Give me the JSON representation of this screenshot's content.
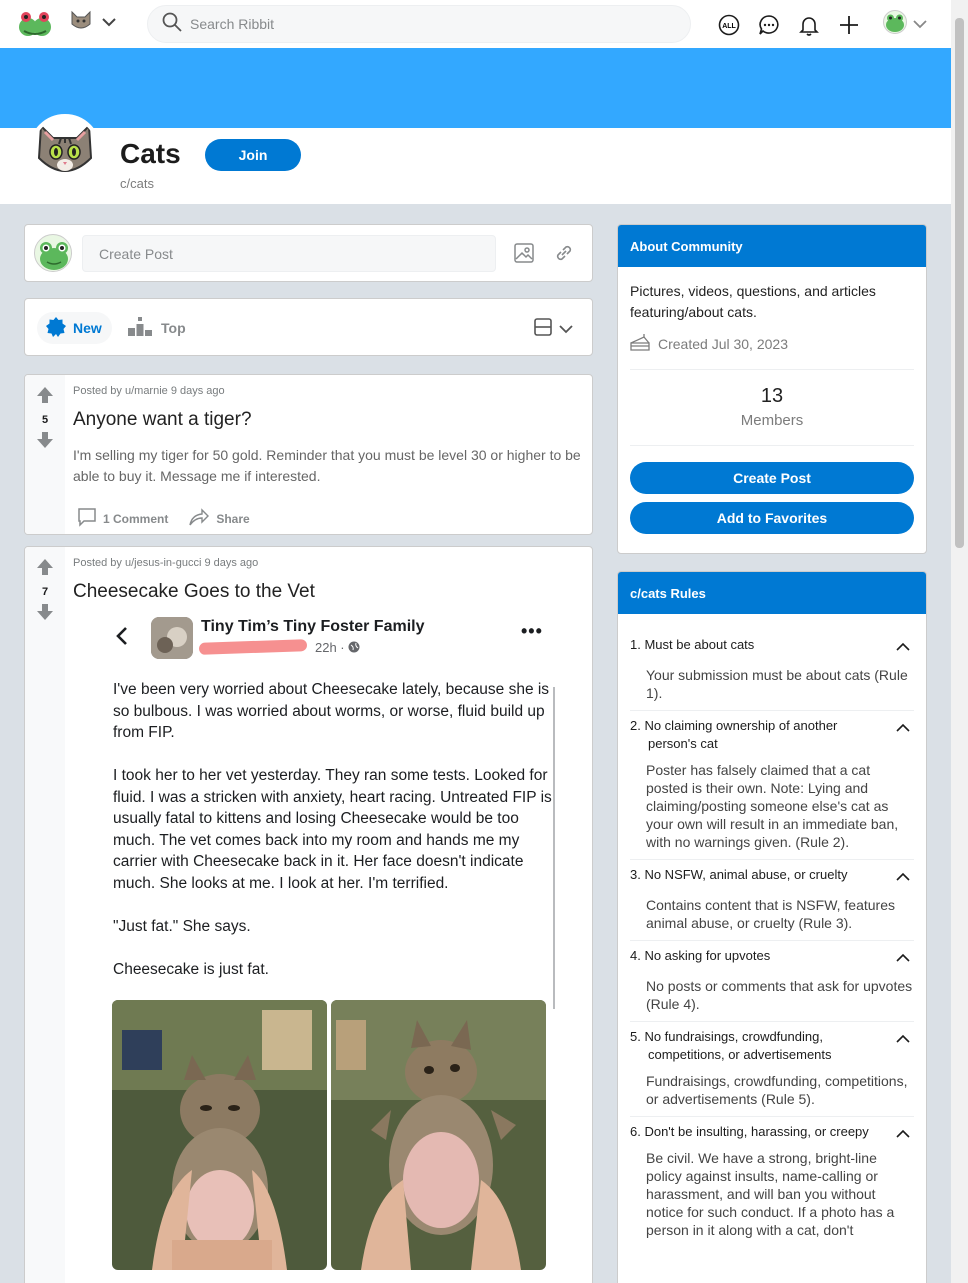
{
  "nav": {
    "search_placeholder": "Search Ribbit",
    "icons": [
      "ribbit-logo-icon",
      "community-cat-icon",
      "chevron-down-icon",
      "all-icon",
      "chat-icon",
      "bell-icon",
      "plus-icon",
      "avatar-frog",
      "chevron-down-icon"
    ],
    "all_label": "ALL"
  },
  "community": {
    "name": "Cats",
    "slug": "c/cats",
    "join_label": "Join",
    "banner_color": "#33a8ff",
    "accent_color": "#0079d3"
  },
  "create_post": {
    "placeholder": "Create Post"
  },
  "sort": {
    "new_label": "New",
    "top_label": "Top"
  },
  "posts": [
    {
      "meta": "Posted by u/marnie 9 days ago",
      "votes": "5",
      "title": "Anyone want a tiger?",
      "body": "I'm selling my tiger for 50 gold. Reminder that you must be level 30 or higher to be able to buy it. Message me if interested.",
      "comments_label": "1 Comment",
      "share_label": "Share"
    },
    {
      "meta": "Posted by u/jesus-in-gucci 9 days ago",
      "votes": "7",
      "title": "Cheesecake Goes to the Vet",
      "embed": {
        "name": "Tiny Tim’s Tiny Foster Family",
        "time": "22h ·",
        "paragraphs": [
          "I've been very worried about Cheesecake lately, because she is so bulbous. I was worried about worms, or worse, fluid build up from FIP.",
          "I took her to her vet yesterday. They ran some tests. Looked for fluid. I was a stricken with anxiety, heart racing. Untreated FIP is usually fatal to kittens and losing Cheesecake would be too much. The vet comes back into my room and hands me my carrier with Cheesecake back in it. Her face doesn't indicate much. She looks at me. I look at her. I'm terrified.",
          "\"Just fat.\" She says.",
          "Cheesecake is just fat."
        ]
      }
    }
  ],
  "about": {
    "header": "About Community",
    "description": "Pictures, videos, questions, and articles featuring/about cats.",
    "created": "Created Jul 30, 2023",
    "members_count": "13",
    "members_label": "Members",
    "create_post_label": "Create Post",
    "favorites_label": "Add to Favorites"
  },
  "rules": {
    "header": "c/cats Rules",
    "items": [
      {
        "title": "1. Must be about cats",
        "desc": "Your submission must be about cats (Rule 1)."
      },
      {
        "title": "2. No claiming ownership of another person's cat",
        "desc": "Poster has falsely claimed that a cat posted is their own. Note: Lying and claiming/posting someone else's cat as your own will result in an immediate ban, with no warnings given. (Rule 2)."
      },
      {
        "title": "3. No NSFW, animal abuse, or cruelty",
        "desc": "Contains content that is NSFW, features animal abuse, or cruelty (Rule 3)."
      },
      {
        "title": "4. No asking for upvotes",
        "desc": "No posts or comments that ask for upvotes (Rule 4)."
      },
      {
        "title": "5. No fundraisings, crowdfunding, competitions, or advertisements",
        "desc": "Fundraisings, crowdfunding, competitions, or advertisements (Rule 5)."
      },
      {
        "title": "6. Don't be insulting, harassing, or creepy",
        "desc": "Be civil. We have a strong, bright-line policy against insults, name-calling or harassment, and will ban you without notice for such conduct. If a photo has a person in it along with a cat, don't"
      }
    ]
  }
}
